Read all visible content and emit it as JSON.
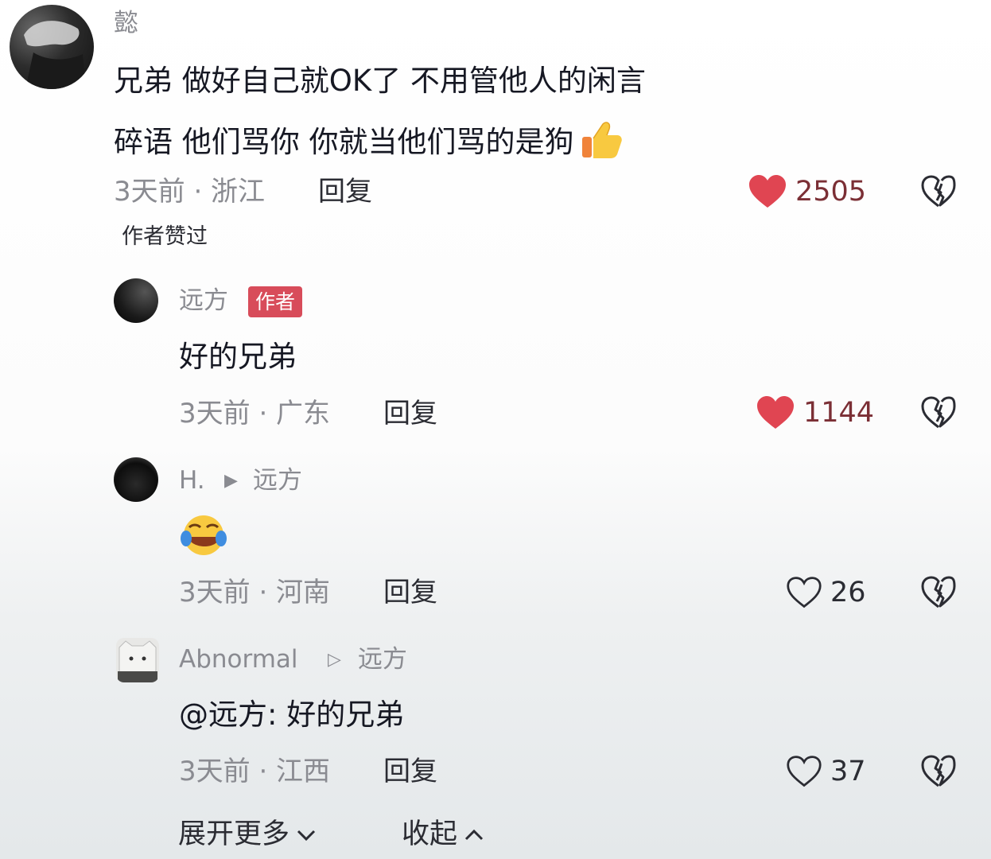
{
  "colors": {
    "liked_heart": "#e04552",
    "liked_count": "#7b2f35",
    "meta_gray": "#8a8b91",
    "author_badge": "#d84c5a",
    "text_dark": "#161823"
  },
  "comments": [
    {
      "username": "懿",
      "text_line1": "兄弟 做好自己就OK了 不用管他人的闲言",
      "text_line2": "碎语 他们骂你 你就当他们骂的是狗",
      "emoji": "thumbs-up-icon",
      "meta": "3天前 · 浙江",
      "reply_label": "回复",
      "like_count": "2505",
      "liked": true,
      "author_liked_label": "作者赞过"
    },
    {
      "username": "远方",
      "badge": "作者",
      "text": "好的兄弟",
      "meta": "3天前 · 广东",
      "reply_label": "回复",
      "like_count": "1144",
      "liked": true
    },
    {
      "username": "H.",
      "reply_to": "远方",
      "emoji": "laughing-crying-emoji-icon",
      "meta": "3天前 · 河南",
      "reply_label": "回复",
      "like_count": "26",
      "liked": false
    },
    {
      "username": "Abnormal",
      "reply_to": "远方",
      "text": "@远方: 好的兄弟",
      "meta": "3天前 · 江西",
      "reply_label": "回复",
      "like_count": "37",
      "liked": false
    }
  ],
  "footer": {
    "expand_label": "展开更多",
    "collapse_label": "收起"
  }
}
